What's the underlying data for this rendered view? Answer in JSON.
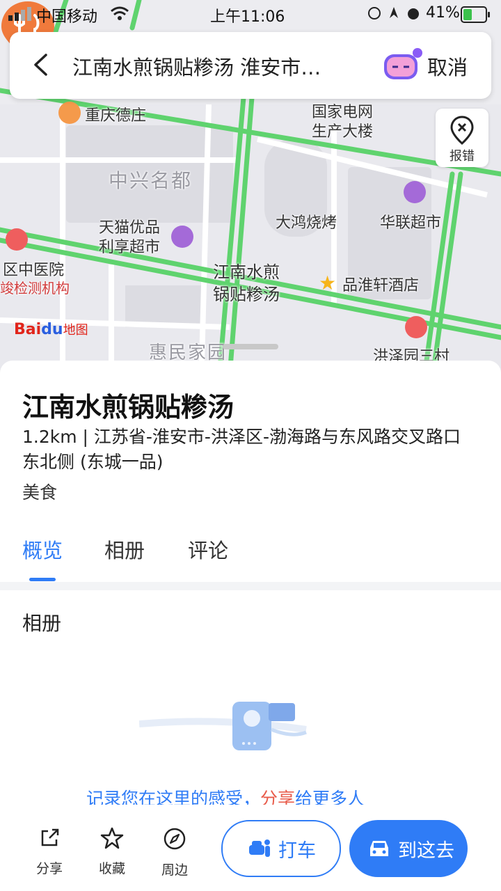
{
  "status_bar": {
    "carrier": "中国移动",
    "time": "上午11:06",
    "battery": "41%"
  },
  "search": {
    "query": "江南水煎锅贴糁汤 淮安市…",
    "cancel": "取消"
  },
  "map": {
    "report_label": "报错",
    "labels": {
      "chongqing": "重庆德庄",
      "guojia": "国家电网\n生产大楼",
      "zhongxing": "中兴名都",
      "tianmao": "天猫优品\n利享超市",
      "dahong": "大鸿烧烤",
      "hualian": "华联超市",
      "hospital": "区中医院",
      "jiance": "竣检测机构",
      "pinhuai": "品淮轩酒店",
      "huimin": "惠民家园",
      "hongze": "洪泽园三村",
      "pin_label": "江南水煎\n锅贴糁汤"
    },
    "logo": {
      "bai": "Bai",
      "du": "du",
      "word": "地图"
    }
  },
  "place": {
    "name": "江南水煎锅贴糁汤",
    "address": "1.2km | 江苏省-淮安市-洪泽区-渤海路与东风路交叉路口东北侧 (东城一品)",
    "category": "美食"
  },
  "tabs": [
    {
      "label": "概览",
      "active": true
    },
    {
      "label": "相册",
      "active": false
    },
    {
      "label": "评论",
      "active": false
    }
  ],
  "album": {
    "title": "相册",
    "empty_text_a": "记录您在这里的感受，",
    "empty_text_b": "分享",
    "empty_text_c": "给更多人"
  },
  "bottom": {
    "share": "分享",
    "favorite": "收藏",
    "nearby": "周边",
    "taxi": "打车",
    "go": "到这去"
  },
  "colors": {
    "accent": "#2f7cf6",
    "road": "#5fd36e",
    "pin": "#f07a3c"
  }
}
